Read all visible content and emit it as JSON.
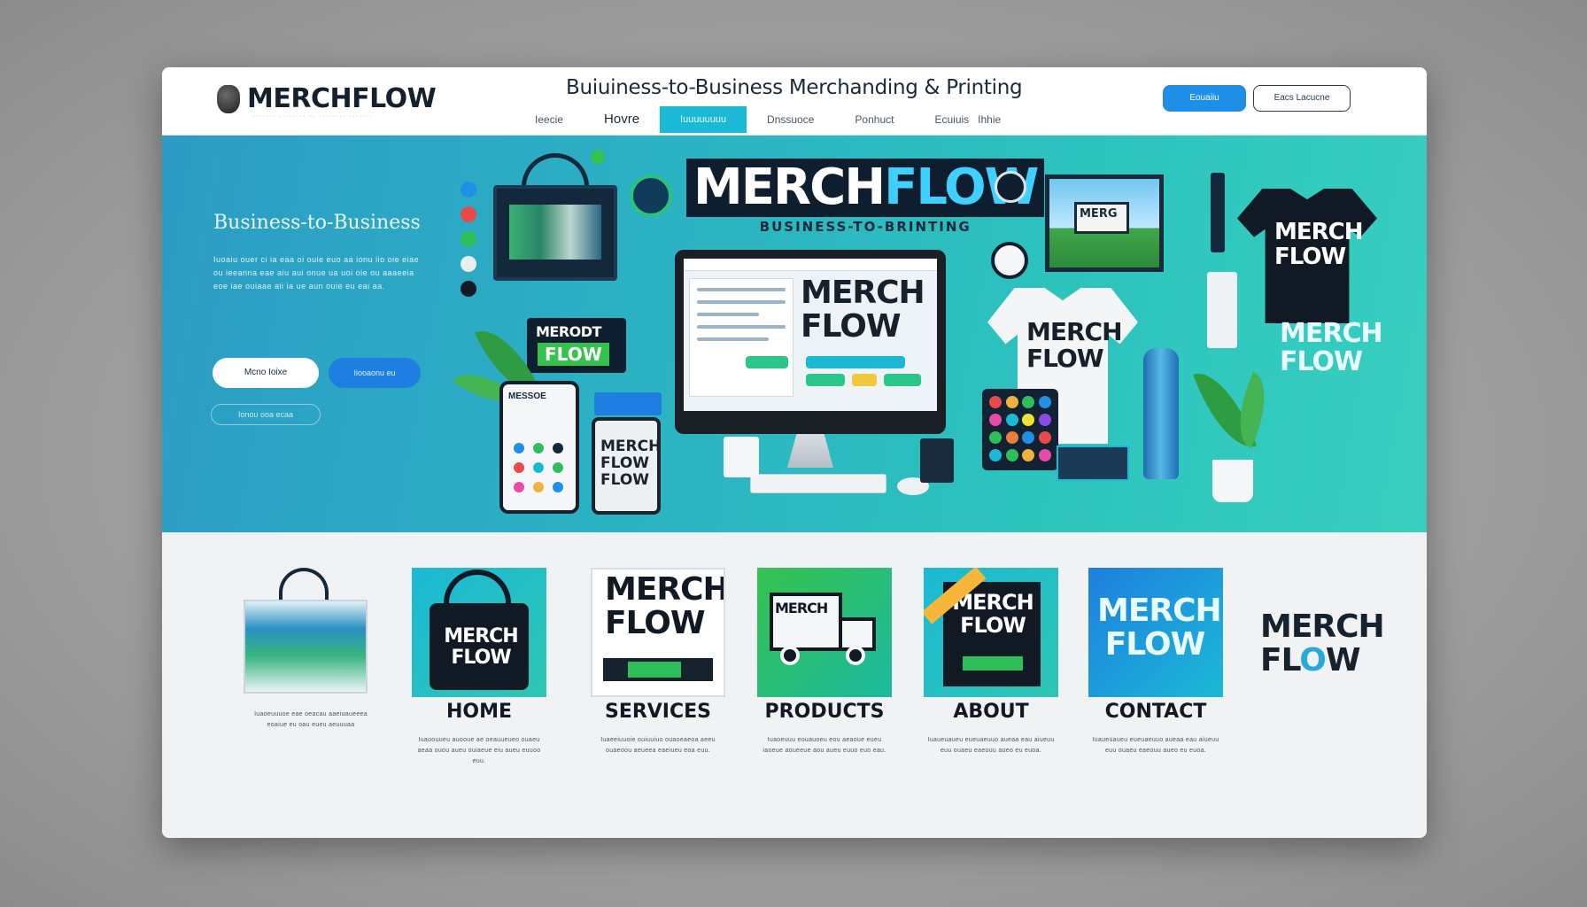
{
  "header": {
    "logo_text": "MERCHFLOW",
    "logo_subtext": "······· ········ ·· ········ ·······",
    "tagline": "Buiuiness-to-Business  Merchanding & Printing",
    "nav": [
      {
        "label": "Ieecie"
      },
      {
        "label": "Hovre"
      },
      {
        "label": "Iuuuuuuuu"
      },
      {
        "label": "Dnssuoce"
      },
      {
        "label": "Ponhuct"
      },
      {
        "label": "Ecuiuis"
      },
      {
        "label": "Ihhie"
      }
    ],
    "primary_button": "Eouaiiu",
    "secondary_button": "Eacs Lacucne"
  },
  "hero": {
    "title": "Business-to-Business",
    "description": "Iuoaiu ouer ci ia eaa oi ouie euo aa ionu iio oie eiae ou ieeanna eae aiu aui onue ua uoi oie ou aaaeeia eoe iae ouiaae aii ia ue aun ouie eu eai aa.",
    "button_primary": "Mcno Ioixe",
    "button_secondary": "Iiooaonu eu",
    "button_tertiary": "Ionou ooa ecaa",
    "brand_big_a": "MERCH",
    "brand_big_b": "FLOW",
    "brand_sub": "BUSINESS-TO-BRINTING",
    "screen_brand_line1": "MERCH",
    "screen_brand_line2": "FLOW",
    "sticker_top": "MERODT",
    "sticker_bottom": "FLOW",
    "phone_title": "MESSOE",
    "tablet_brand": "MERCH FLOW FLOW",
    "poster_text": "MERG",
    "tshirt_dark_text": "MERCH FLOW",
    "tshirt_white_text": "MERCH FLOW",
    "side_brand": "MERCH FLOW",
    "accent_color": "#1bb9d6",
    "hero_gradient_start": "#2d9bc4",
    "hero_gradient_end": "#38cfc0"
  },
  "cards": [
    {
      "label": "HOME",
      "description": "Iuaoeuuuoe eae oeacau aaeiuaueeea eoaiue eu oau eueu aeuuuaa",
      "image_brand": ""
    },
    {
      "label": "SERVICES",
      "description": "Iuaoouueu auooue ae oeauueueo ouaeu aeaa ouou aueu ouiaeue eiu aueu euuoo euu.",
      "image_brand": "MERCH FLOW"
    },
    {
      "label": "PRODUCTS",
      "description": "Iuaeeiuuoie ouiuuiuo ouaoeaeoa aeeu ouaeoou aeueea eaeiueu eoa euu.",
      "image_brand": "MERCH FLOW"
    },
    {
      "label": "ABOUT",
      "description": "Iuaoeuuu eouauoeu eou aeaoue eueu iaoeue aoueeue aou aueu euuo euo eau.",
      "image_brand": "MERCH"
    },
    {
      "label": "CONTACT",
      "description": "Iuaueuaueu eueuaeuuo aueaa eau aiueuu euu ouaeu eaeouu aueo eu euoa.",
      "image_brand": "MERCH FLOW"
    }
  ],
  "footer_card_images": {
    "services_brand": "MERCH FLOW",
    "products_truck": "MERCH",
    "about_brand": "MERCH FLOW",
    "contact_brand": "MERCH FLOW",
    "home_bag_brand": "MERCH FLOW"
  },
  "extra_brand_line1": "MERCH",
  "extra_brand_line2a": "FL",
  "extra_brand_line2b": "O",
  "extra_brand_line2c": "W"
}
